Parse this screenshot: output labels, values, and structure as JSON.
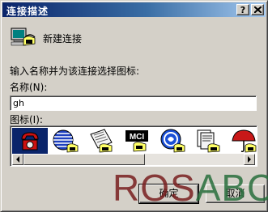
{
  "window": {
    "title": "连接描述",
    "help_glyph": "?"
  },
  "connection": {
    "label": "新建连接",
    "icon": "network-computer-icon"
  },
  "instruction": "输入名称并为该连接选择图标:",
  "name_field": {
    "label": "名称(N):",
    "value": "gh"
  },
  "icon_picker": {
    "label": "图标(I):",
    "icons": [
      {
        "icon": "red-phone-icon",
        "selected": true
      },
      {
        "icon": "globe-phone-icon",
        "selected": false
      },
      {
        "icon": "newspaper-phone-icon",
        "selected": false
      },
      {
        "icon": "mci-phone-icon",
        "selected": false
      },
      {
        "icon": "ge-logo-phone-icon",
        "selected": false
      },
      {
        "icon": "documents-phone-icon",
        "selected": false
      },
      {
        "icon": "umbrella-phone-icon",
        "selected": false
      }
    ],
    "mci_text": "MCI"
  },
  "buttons": {
    "ok": "确定",
    "cancel": "取消"
  },
  "watermark": {
    "part1": "ROS",
    "part2": "ABC"
  }
}
